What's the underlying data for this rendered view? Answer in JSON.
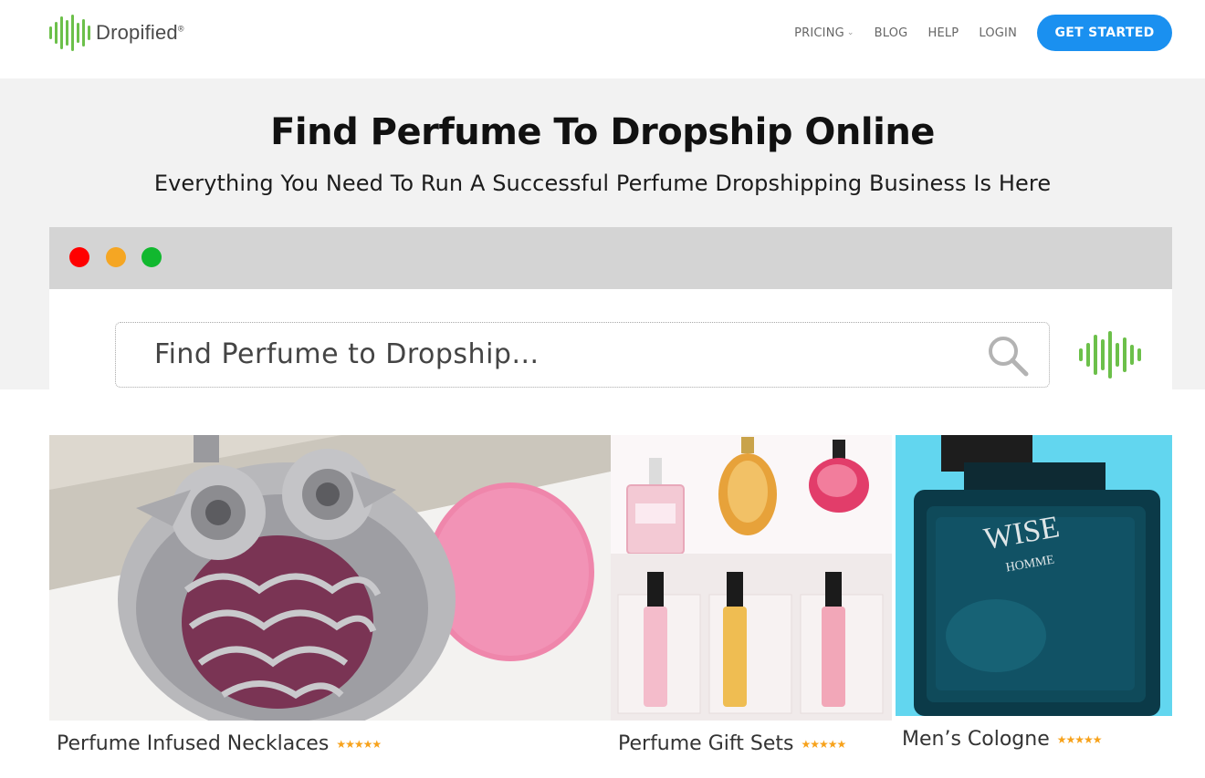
{
  "brand": {
    "name": "Dropified",
    "mark": "®"
  },
  "nav": {
    "items": [
      {
        "label": "PRICING",
        "has_caret": true
      },
      {
        "label": "BLOG"
      },
      {
        "label": "HELP"
      },
      {
        "label": "LOGIN"
      }
    ],
    "cta_label": "GET STARTED",
    "cta_color": "#1a90f0"
  },
  "hero": {
    "title": "Find Perfume To Dropship Online",
    "subtitle": "Everything You Need To Run A Successful Perfume Dropshipping Business Is Here"
  },
  "search": {
    "placeholder": "Find Perfume to Dropship..."
  },
  "window_controls": {
    "colors": [
      "#ff0000",
      "#f5a623",
      "#11b82f"
    ]
  },
  "products": [
    {
      "label": "Perfume Infused Necklaces",
      "stars": "★★★★★",
      "rating": 5
    },
    {
      "label": "Perfume Gift Sets",
      "stars": "★★★★★",
      "rating": 5
    },
    {
      "label": "Men’s Cologne",
      "stars": "★★★★★",
      "rating": 5,
      "bottle_text_1": "WISE",
      "bottle_text_2": "HOMME"
    }
  ],
  "colors": {
    "accent": "#1a90f0",
    "brand_green": "#6cc04a",
    "star": "#f7a21b"
  }
}
